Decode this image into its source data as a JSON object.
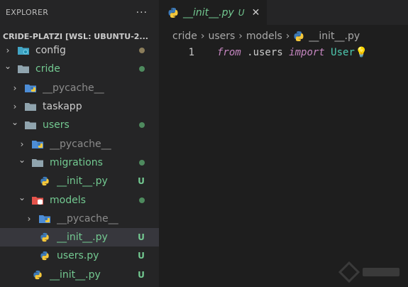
{
  "sidebar": {
    "title": "EXPLORER",
    "more": "···",
    "root": "CRIDE-PLATZI [WSL: UBUNTU-2...",
    "items": [
      {
        "label": "config",
        "kind": "folder-config",
        "expanded": false,
        "depth": 0,
        "color": "#cccccc",
        "status": "dot",
        "status_color": "#8b7d5b"
      },
      {
        "label": "cride",
        "kind": "folder",
        "expanded": true,
        "depth": 0,
        "color": "#73c991",
        "status": "dot",
        "status_color": "#4e8a5e"
      },
      {
        "label": "__pycache__",
        "kind": "folder-python",
        "expanded": false,
        "depth": 1,
        "color": "#8b8b8b",
        "status": "",
        "status_color": ""
      },
      {
        "label": "taskapp",
        "kind": "folder",
        "expanded": false,
        "depth": 1,
        "color": "#cccccc",
        "status": "",
        "status_color": ""
      },
      {
        "label": "users",
        "kind": "folder",
        "expanded": true,
        "depth": 1,
        "color": "#73c991",
        "status": "dot",
        "status_color": "#4e8a5e"
      },
      {
        "label": "__pycache__",
        "kind": "folder-python",
        "expanded": false,
        "depth": 2,
        "color": "#8b8b8b",
        "status": "",
        "status_color": ""
      },
      {
        "label": "migrations",
        "kind": "folder",
        "expanded": true,
        "depth": 2,
        "color": "#73c991",
        "status": "dot",
        "status_color": "#4e8a5e"
      },
      {
        "label": "__init__.py",
        "kind": "python",
        "expanded": null,
        "depth": 3,
        "color": "#73c991",
        "status": "U",
        "status_color": "#73c991"
      },
      {
        "label": "models",
        "kind": "folder-db",
        "expanded": true,
        "depth": 2,
        "color": "#73c991",
        "status": "dot",
        "status_color": "#4e8a5e"
      },
      {
        "label": "__pycache__",
        "kind": "folder-python",
        "expanded": false,
        "depth": 3,
        "color": "#8b8b8b",
        "status": "",
        "status_color": ""
      },
      {
        "label": "__init__.py",
        "kind": "python",
        "expanded": null,
        "depth": 3,
        "color": "#73c991",
        "status": "U",
        "status_color": "#73c991",
        "selected": true
      },
      {
        "label": "users.py",
        "kind": "python",
        "expanded": null,
        "depth": 3,
        "color": "#73c991",
        "status": "U",
        "status_color": "#73c991"
      },
      {
        "label": "__init__.py",
        "kind": "python",
        "expanded": null,
        "depth": 2,
        "color": "#73c991",
        "status": "U",
        "status_color": "#73c991"
      }
    ]
  },
  "tab": {
    "label": "__init__.py",
    "status": "U",
    "close": "✕"
  },
  "breadcrumb": [
    "cride",
    "users",
    "models",
    "__init__.py"
  ],
  "breadcrumb_sep": "›",
  "code": {
    "line_number": "1",
    "tokens": [
      {
        "text": "from",
        "cls": "kw"
      },
      {
        "text": " .users ",
        "cls": "mod"
      },
      {
        "text": "import",
        "cls": "kw"
      },
      {
        "text": " User",
        "cls": "cls"
      }
    ],
    "bulb": "💡"
  },
  "colors": {
    "accent_green": "#73c991",
    "keyword": "#c586c0",
    "class": "#4ec9b0"
  }
}
